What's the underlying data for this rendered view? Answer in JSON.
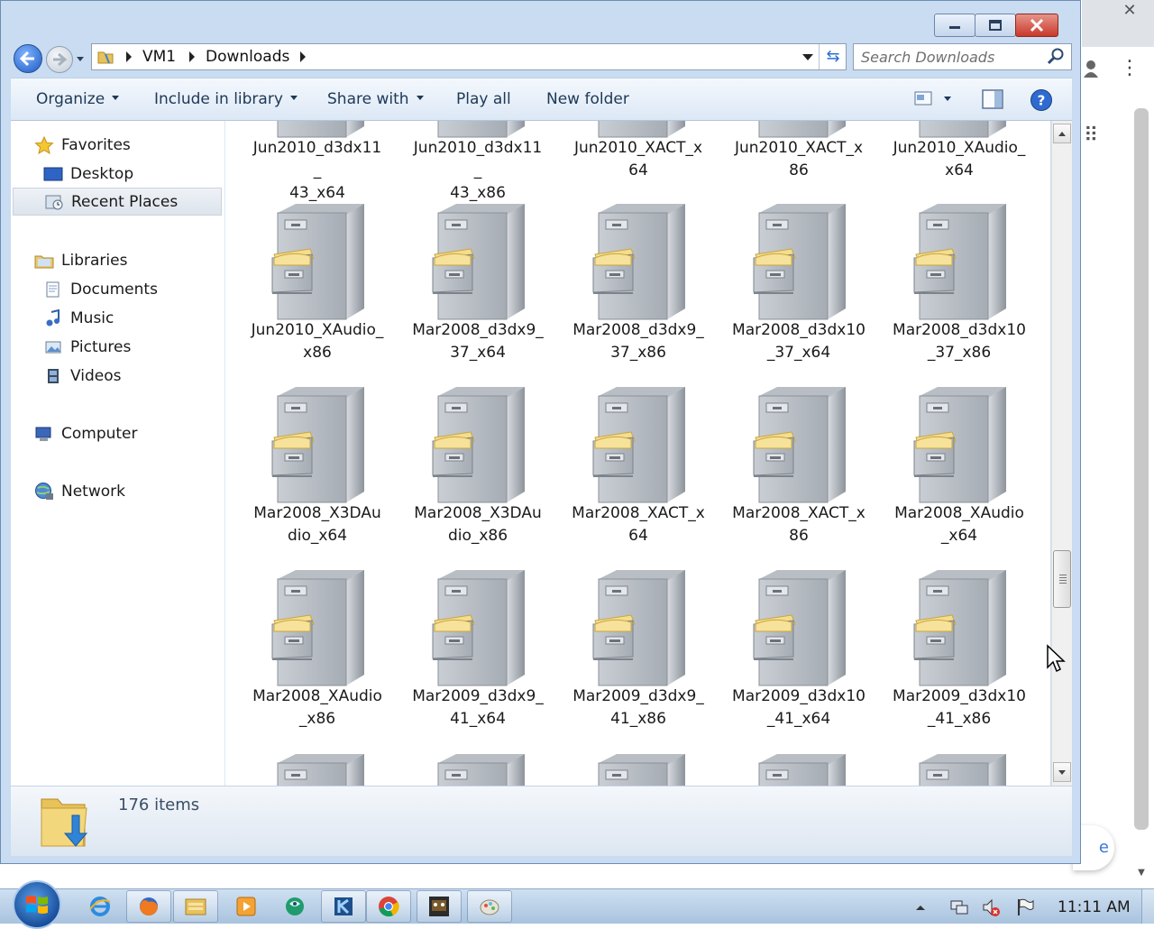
{
  "window": {
    "breadcrumbs": [
      "VM1",
      "Downloads"
    ],
    "search_placeholder": "Search Downloads"
  },
  "toolbar": {
    "organize": "Organize",
    "include_in_library": "Include in library",
    "share_with": "Share with",
    "play_all": "Play all",
    "new_folder": "New folder"
  },
  "nav": {
    "favorites": "Favorites",
    "desktop": "Desktop",
    "recent_places": "Recent Places",
    "libraries": "Libraries",
    "documents": "Documents",
    "music": "Music",
    "pictures": "Pictures",
    "videos": "Videos",
    "computer": "Computer",
    "network": "Network"
  },
  "files": {
    "row0": [
      "Jun2010_d3dx11_\n43_x64",
      "Jun2010_d3dx11_\n43_x86",
      "Jun2010_XACT_x\n64",
      "Jun2010_XACT_x\n86",
      "Jun2010_XAudio_\nx64"
    ],
    "row1": [
      "Jun2010_XAudio_\nx86",
      "Mar2008_d3dx9_\n37_x64",
      "Mar2008_d3dx9_\n37_x86",
      "Mar2008_d3dx10\n_37_x64",
      "Mar2008_d3dx10\n_37_x86"
    ],
    "row2": [
      "Mar2008_X3DAu\ndio_x64",
      "Mar2008_X3DAu\ndio_x86",
      "Mar2008_XACT_x\n64",
      "Mar2008_XACT_x\n86",
      "Mar2008_XAudio\n_x64"
    ],
    "row3": [
      "Mar2008_XAudio\n_x86",
      "Mar2009_d3dx9_\n41_x64",
      "Mar2009_d3dx9_\n41_x86",
      "Mar2009_d3dx10\n_41_x64",
      "Mar2009_d3dx10\n_41_x86"
    ]
  },
  "details": {
    "item_count": "176 items"
  },
  "taskbar": {
    "clock": "11:11 AM"
  },
  "background_app": {
    "bubble_text": "e"
  },
  "colors": {
    "window_frame": "#c9dcf1",
    "toolbar_text": "#1e3857",
    "close_button": "#c8392a",
    "taskbar": "#a9c3de"
  },
  "icons": [
    "back-arrow-icon",
    "forward-arrow-icon",
    "folder-icon",
    "refresh-icon",
    "search-icon",
    "view-options-icon",
    "preview-pane-icon",
    "help-icon",
    "star-icon",
    "desktop-icon",
    "recent-places-icon",
    "library-icon",
    "documents-icon",
    "music-icon",
    "pictures-icon",
    "videos-icon",
    "computer-icon",
    "network-icon",
    "file-cabinet-icon",
    "downloads-folder-icon",
    "windows-logo-icon",
    "internet-explorer-icon",
    "firefox-icon",
    "explorer-icon",
    "media-player-icon",
    "chrome-icon",
    "flag-icon",
    "volume-muted-icon",
    "network-tray-icon"
  ]
}
